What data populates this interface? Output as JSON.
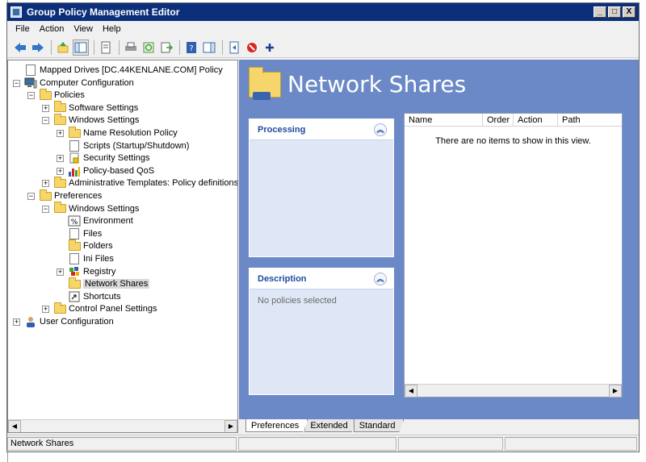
{
  "window": {
    "title": "Group Policy Management Editor",
    "controls": [
      "_",
      "□",
      "X"
    ]
  },
  "menubar": [
    "File",
    "Action",
    "View",
    "Help"
  ],
  "toolbar": {
    "icons": [
      "back-icon",
      "forward-icon",
      "up-icon",
      "show-hide-tree-icon",
      "properties-icon",
      "print-icon",
      "refresh-icon",
      "export-list-icon",
      "help-icon",
      "show-hide-action-pane-icon",
      "move-icon",
      "stop-icon",
      "add-icon"
    ]
  },
  "tree": {
    "nodes": [
      {
        "label": "Mapped Drives [DC.44KENLANE.COM] Policy",
        "level": 0,
        "expander": "",
        "icon": "policy-icon"
      },
      {
        "label": "Computer Configuration",
        "level": 0,
        "expander": "−",
        "icon": "computer-icon"
      },
      {
        "label": "Policies",
        "level": 1,
        "expander": "−",
        "icon": "folder-icon"
      },
      {
        "label": "Software Settings",
        "level": 2,
        "expander": "+",
        "icon": "folder-icon"
      },
      {
        "label": "Windows Settings",
        "level": 2,
        "expander": "−",
        "icon": "folder-icon"
      },
      {
        "label": "Name Resolution Policy",
        "level": 3,
        "expander": "+",
        "icon": "folder-icon"
      },
      {
        "label": "Scripts (Startup/Shutdown)",
        "level": 3,
        "expander": "",
        "icon": "scripts-icon"
      },
      {
        "label": "Security Settings",
        "level": 3,
        "expander": "+",
        "icon": "security-icon"
      },
      {
        "label": "Policy-based QoS",
        "level": 3,
        "expander": "+",
        "icon": "qos-chart-icon"
      },
      {
        "label": "Administrative Templates: Policy definitions",
        "level": 2,
        "expander": "+",
        "icon": "folder-icon"
      },
      {
        "label": "Preferences",
        "level": 1,
        "expander": "−",
        "icon": "folder-icon"
      },
      {
        "label": "Windows Settings",
        "level": 2,
        "expander": "−",
        "icon": "folder-icon"
      },
      {
        "label": "Environment",
        "level": 3,
        "expander": "",
        "icon": "environment-icon"
      },
      {
        "label": "Files",
        "level": 3,
        "expander": "",
        "icon": "files-icon"
      },
      {
        "label": "Folders",
        "level": 3,
        "expander": "",
        "icon": "folder-icon"
      },
      {
        "label": "Ini Files",
        "level": 3,
        "expander": "",
        "icon": "ini-file-icon"
      },
      {
        "label": "Registry",
        "level": 3,
        "expander": "+",
        "icon": "registry-icon"
      },
      {
        "label": "Network Shares",
        "level": 3,
        "expander": "",
        "icon": "network-share-icon",
        "selected": true
      },
      {
        "label": "Shortcuts",
        "level": 3,
        "expander": "",
        "icon": "shortcut-icon"
      },
      {
        "label": "Control Panel Settings",
        "level": 2,
        "expander": "+",
        "icon": "folder-icon"
      },
      {
        "label": "User Configuration",
        "level": 0,
        "expander": "+",
        "icon": "user-icon"
      }
    ]
  },
  "right_pane": {
    "title": "Network Shares",
    "processing": {
      "title": "Processing",
      "collapse": "︽"
    },
    "description": {
      "title": "Description",
      "collapse": "︽",
      "text": "No policies selected"
    },
    "list": {
      "columns": [
        "Name",
        "Order",
        "Action",
        "Path"
      ],
      "empty_text": "There are no items to show in this view."
    }
  },
  "tabs": [
    "Preferences",
    "Extended",
    "Standard"
  ],
  "statusbar": {
    "text": "Network Shares"
  },
  "colors": {
    "titlebar": "#0b2f7a",
    "pane_bg": "#6b89c7",
    "panel_title": "#1f4aa0"
  }
}
